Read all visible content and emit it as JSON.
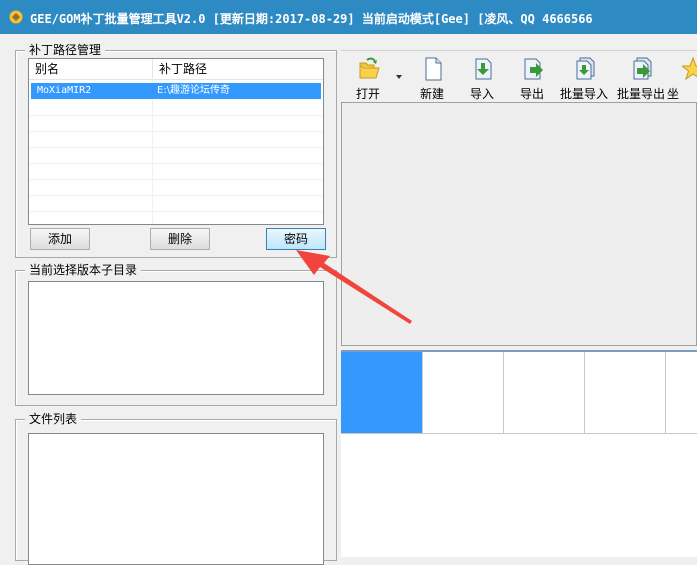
{
  "window": {
    "title": "GEE/GOM补丁批量管理工具V2.0 [更新日期:2017-08-29]    当前启动模式[Gee]    [凌风、QQ 4666566"
  },
  "patch_group": {
    "label": "补丁路径管理",
    "columns": [
      "别名",
      "补丁路径"
    ],
    "rows": [
      {
        "alias": "MoXiaMIR2",
        "path": "E:\\趣游论坛传奇",
        "selected": true
      }
    ],
    "buttons": {
      "add": "添加",
      "delete": "删除",
      "password": "密码"
    }
  },
  "subdir_group": {
    "label": "当前选择版本子目录"
  },
  "files_group": {
    "label": "文件列表"
  },
  "toolbar": {
    "items": [
      {
        "name": "open",
        "label": "打开",
        "icon": "open-folder-icon"
      },
      {
        "name": "new",
        "label": "新建",
        "icon": "new-file-icon"
      },
      {
        "name": "import",
        "label": "导入",
        "icon": "import-icon"
      },
      {
        "name": "export",
        "label": "导出",
        "icon": "export-icon"
      },
      {
        "name": "batch-import",
        "label": "批量导入",
        "icon": "batch-import-icon"
      },
      {
        "name": "batch-export",
        "label": "批量导出",
        "icon": "batch-export-icon"
      },
      {
        "name": "coords",
        "label": "坐",
        "icon": "star-icon"
      }
    ]
  },
  "colors": {
    "title_bar": "#2d8ac3",
    "selection": "#3399ff",
    "annotation_arrow": "#f0443c"
  }
}
